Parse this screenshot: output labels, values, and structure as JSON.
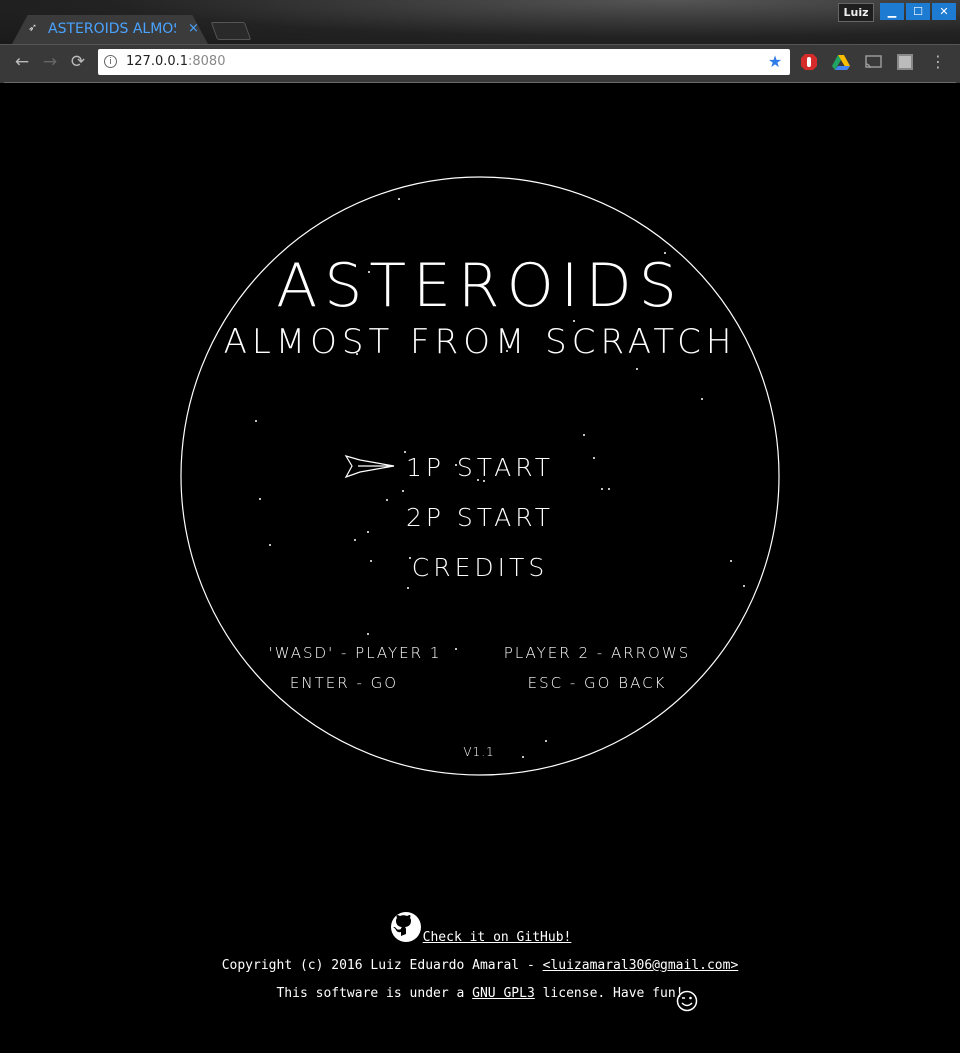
{
  "browser": {
    "tab_title": "ASTEROIDS ALMOS",
    "tab_close": "×",
    "profile": "Luiz",
    "url_host": "127.0.0.1",
    "url_port": ":8080",
    "back": "←",
    "forward": "→",
    "reload": "⟳",
    "star": "★",
    "menu": "⋮",
    "win_min": "▁",
    "win_max": "☐",
    "win_close": "✕"
  },
  "game": {
    "title": "ASTEROIDS",
    "subtitle": "ALMOST FROM SCRATCH",
    "menu": {
      "start_1p": "1P START",
      "start_2p": "2P START",
      "credits": "CREDITS"
    },
    "controls": {
      "p1": "'WASD' - PLAYER 1",
      "p2": "PLAYER 2 - ARROWS",
      "enter": "ENTER - GO",
      "esc": "ESC - GO BACK"
    },
    "version": "V1.1"
  },
  "footer": {
    "github_link": "Check it on GitHub!",
    "copyright_prefix": "Copyright (c) 2016 Luiz Eduardo Amaral - ",
    "email": "<luizamaral306@gmail.com>",
    "license_prefix": "This software is under a ",
    "license_link": "GNU GPL3",
    "license_suffix": " license. Have fun!",
    "wink": "😉"
  },
  "colors": {
    "tab_text": "#4aa3ff",
    "window_button": "#1d7bd2",
    "star": "#2f7ce8",
    "game_fg": "#ffffff",
    "game_bg": "#000000"
  },
  "icons": [
    "rocket-icon",
    "github-icon",
    "wink-icon",
    "adblock-icon",
    "drive-icon",
    "cast-icon",
    "extension-tc-icon"
  ]
}
